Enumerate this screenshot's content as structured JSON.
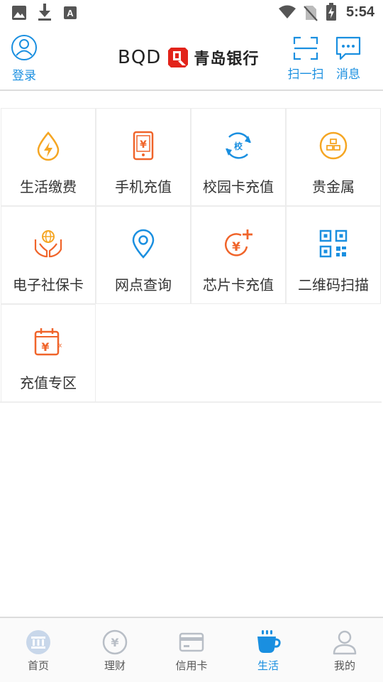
{
  "status_bar": {
    "time": "5:54",
    "icons": [
      "image-icon",
      "download-icon",
      "font-icon",
      "wifi-icon",
      "no-sim-icon",
      "battery-charging-icon"
    ]
  },
  "header": {
    "login_label": "登录",
    "brand_latin": "BQD",
    "brand_name": "青岛银行",
    "scan_label": "扫一扫",
    "message_label": "消息"
  },
  "services": [
    {
      "label": "生活缴费",
      "icon": "water-drop-bolt-icon"
    },
    {
      "label": "手机充值",
      "icon": "phone-yuan-icon"
    },
    {
      "label": "校园卡充值",
      "icon": "campus-card-icon"
    },
    {
      "label": "贵金属",
      "icon": "gold-bars-icon"
    },
    {
      "label": "电子社保卡",
      "icon": "hands-globe-icon"
    },
    {
      "label": "网点查询",
      "icon": "location-pin-icon"
    },
    {
      "label": "芯片卡充值",
      "icon": "yuan-plus-icon"
    },
    {
      "label": "二维码扫描",
      "icon": "qr-code-icon"
    },
    {
      "label": "充值专区",
      "icon": "calendar-yuan-icon"
    }
  ],
  "tabs": [
    {
      "label": "首页",
      "icon": "bank-icon",
      "active": false
    },
    {
      "label": "理财",
      "icon": "yuan-coin-icon",
      "active": false
    },
    {
      "label": "信用卡",
      "icon": "credit-card-icon",
      "active": false
    },
    {
      "label": "生活",
      "icon": "coffee-cup-icon",
      "active": true
    },
    {
      "label": "我的",
      "icon": "person-icon",
      "active": false
    }
  ],
  "colors": {
    "accent": "#1a8fe0",
    "orange": "#f5a623",
    "orange_red": "#f0642a",
    "brand_red": "#e2231a",
    "tab_inactive": "#b8bec6"
  }
}
